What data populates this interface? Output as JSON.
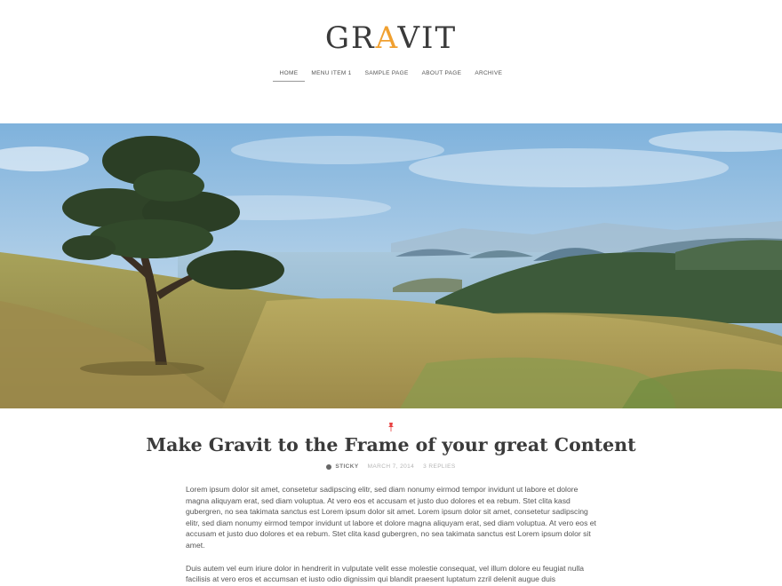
{
  "site": {
    "logo_part1": "GR",
    "logo_accent": "A",
    "logo_part2": "VIT",
    "accent_color": "#f0a030"
  },
  "nav": {
    "items": [
      {
        "label": "HOME"
      },
      {
        "label": "MENU ITEM 1"
      },
      {
        "label": "SAMPLE PAGE"
      },
      {
        "label": "ABOUT PAGE"
      },
      {
        "label": "ARCHIVE"
      }
    ]
  },
  "hero": {
    "icon": "landscape-photo"
  },
  "post": {
    "pin_icon": "pushpin-icon",
    "pin_color": "#e84040",
    "title": "Make Gravit to the Frame of your great Content",
    "meta": {
      "sticky": "STICKY",
      "date": "MARCH 7, 2014",
      "replies": "3 REPLIES"
    },
    "paragraphs": [
      "Lorem ipsum dolor sit amet, consetetur sadipscing elitr, sed diam nonumy eirmod tempor invidunt ut labore et dolore magna aliquyam erat, sed diam voluptua. At vero eos et accusam et justo duo dolores et ea rebum. Stet clita kasd gubergren, no sea takimata sanctus est Lorem ipsum dolor sit amet. Lorem ipsum dolor sit amet, consetetur sadipscing elitr, sed diam nonumy eirmod tempor invidunt ut labore et dolore magna aliquyam erat, sed diam voluptua. At vero eos et accusam et justo duo dolores et ea rebum. Stet clita kasd gubergren, no sea takimata sanctus est Lorem ipsum dolor sit amet.",
      "Duis autem vel eum iriure dolor in hendrerit in vulputate velit esse molestie consequat, vel illum dolore eu feugiat nulla facilisis at vero eros et accumsan et iusto odio dignissim qui blandit praesent luptatum zzril delenit augue duis"
    ]
  }
}
